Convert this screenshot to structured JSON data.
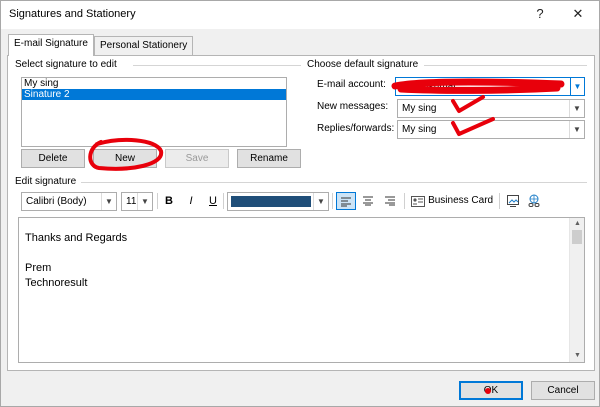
{
  "window": {
    "title": "Signatures and Stationery",
    "help_glyph": "?",
    "close_glyph": "✕"
  },
  "tabs": [
    {
      "label": "E-mail Signature",
      "active": true
    },
    {
      "label": "Personal Stationery",
      "active": false
    }
  ],
  "select_group": {
    "heading": "Select signature to edit",
    "items": [
      {
        "label": "My sing",
        "selected": false
      },
      {
        "label": "Sinature 2",
        "selected": true
      }
    ],
    "buttons": {
      "delete": "Delete",
      "new": "New",
      "save": "Save",
      "rename": "Rename"
    }
  },
  "default_group": {
    "heading": "Choose default signature",
    "email_account_label": "E-mail account:",
    "email_account_value": "premkumar",
    "new_messages_label": "New messages:",
    "new_messages_value": "My sing",
    "replies_label": "Replies/forwards:",
    "replies_value": "My sing"
  },
  "edit_group": {
    "heading": "Edit signature",
    "font_name": "Calibri (Body)",
    "font_size": "11",
    "bold": "B",
    "italic": "I",
    "underline": "U",
    "font_color": "#1f4e79",
    "business_card_label": "Business Card",
    "body_lines": [
      "Thanks and Regards",
      "",
      "Prem",
      "Technoresult"
    ]
  },
  "footer": {
    "ok": "OK",
    "cancel": "Cancel"
  },
  "colors": {
    "accent": "#0078d7",
    "annotation": "#e8000b"
  }
}
